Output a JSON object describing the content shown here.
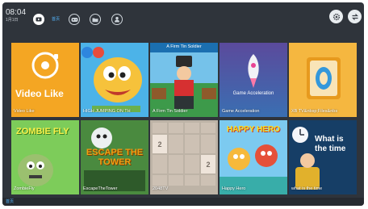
{
  "clock": {
    "time": "08:04",
    "date": "1月1日"
  },
  "nav": {
    "tabs": [
      {
        "name": "video",
        "icon": "video-icon",
        "active": true
      },
      {
        "name": "games",
        "icon": "gamepad-icon",
        "active": false
      },
      {
        "name": "folder",
        "icon": "folder-icon",
        "active": false
      },
      {
        "name": "user",
        "icon": "user-icon",
        "active": false
      }
    ],
    "active_label": "首页"
  },
  "toolbar": {
    "settings_icon": "gear-icon",
    "switch_icon": "swap-icon"
  },
  "tiles": [
    {
      "label": "Video Like",
      "art_text": "Video Like"
    },
    {
      "label": "HIGH JUMPING ON TH",
      "art_text": ""
    },
    {
      "label": "A Firm Tin Soldier",
      "art_text": "A Firm Tin Soldier"
    },
    {
      "label": "Game Acceleration",
      "art_text": "Game Acceleration"
    },
    {
      "label": "XB TV&nbsp;Files&nbs",
      "art_text": ""
    },
    {
      "label": "ZombieFly",
      "art_text": "ZOMBIE FLY"
    },
    {
      "label": "EscapeTheTower",
      "art_text": "ESCAPE THE TOWER"
    },
    {
      "label": "2048TV",
      "art_text": ""
    },
    {
      "label": "Happy Hero",
      "art_text": "HAPPY HERO"
    },
    {
      "label": "what is the time",
      "art_text": "What is the time"
    }
  ],
  "board_2048": [
    "",
    "",
    "",
    "",
    "2",
    "",
    "",
    "",
    "",
    "",
    "",
    "2",
    "",
    "",
    "",
    ""
  ],
  "bottom": {
    "label": "首页"
  },
  "colors": {
    "accent": "#54b7ff",
    "background": "#2f343b"
  }
}
